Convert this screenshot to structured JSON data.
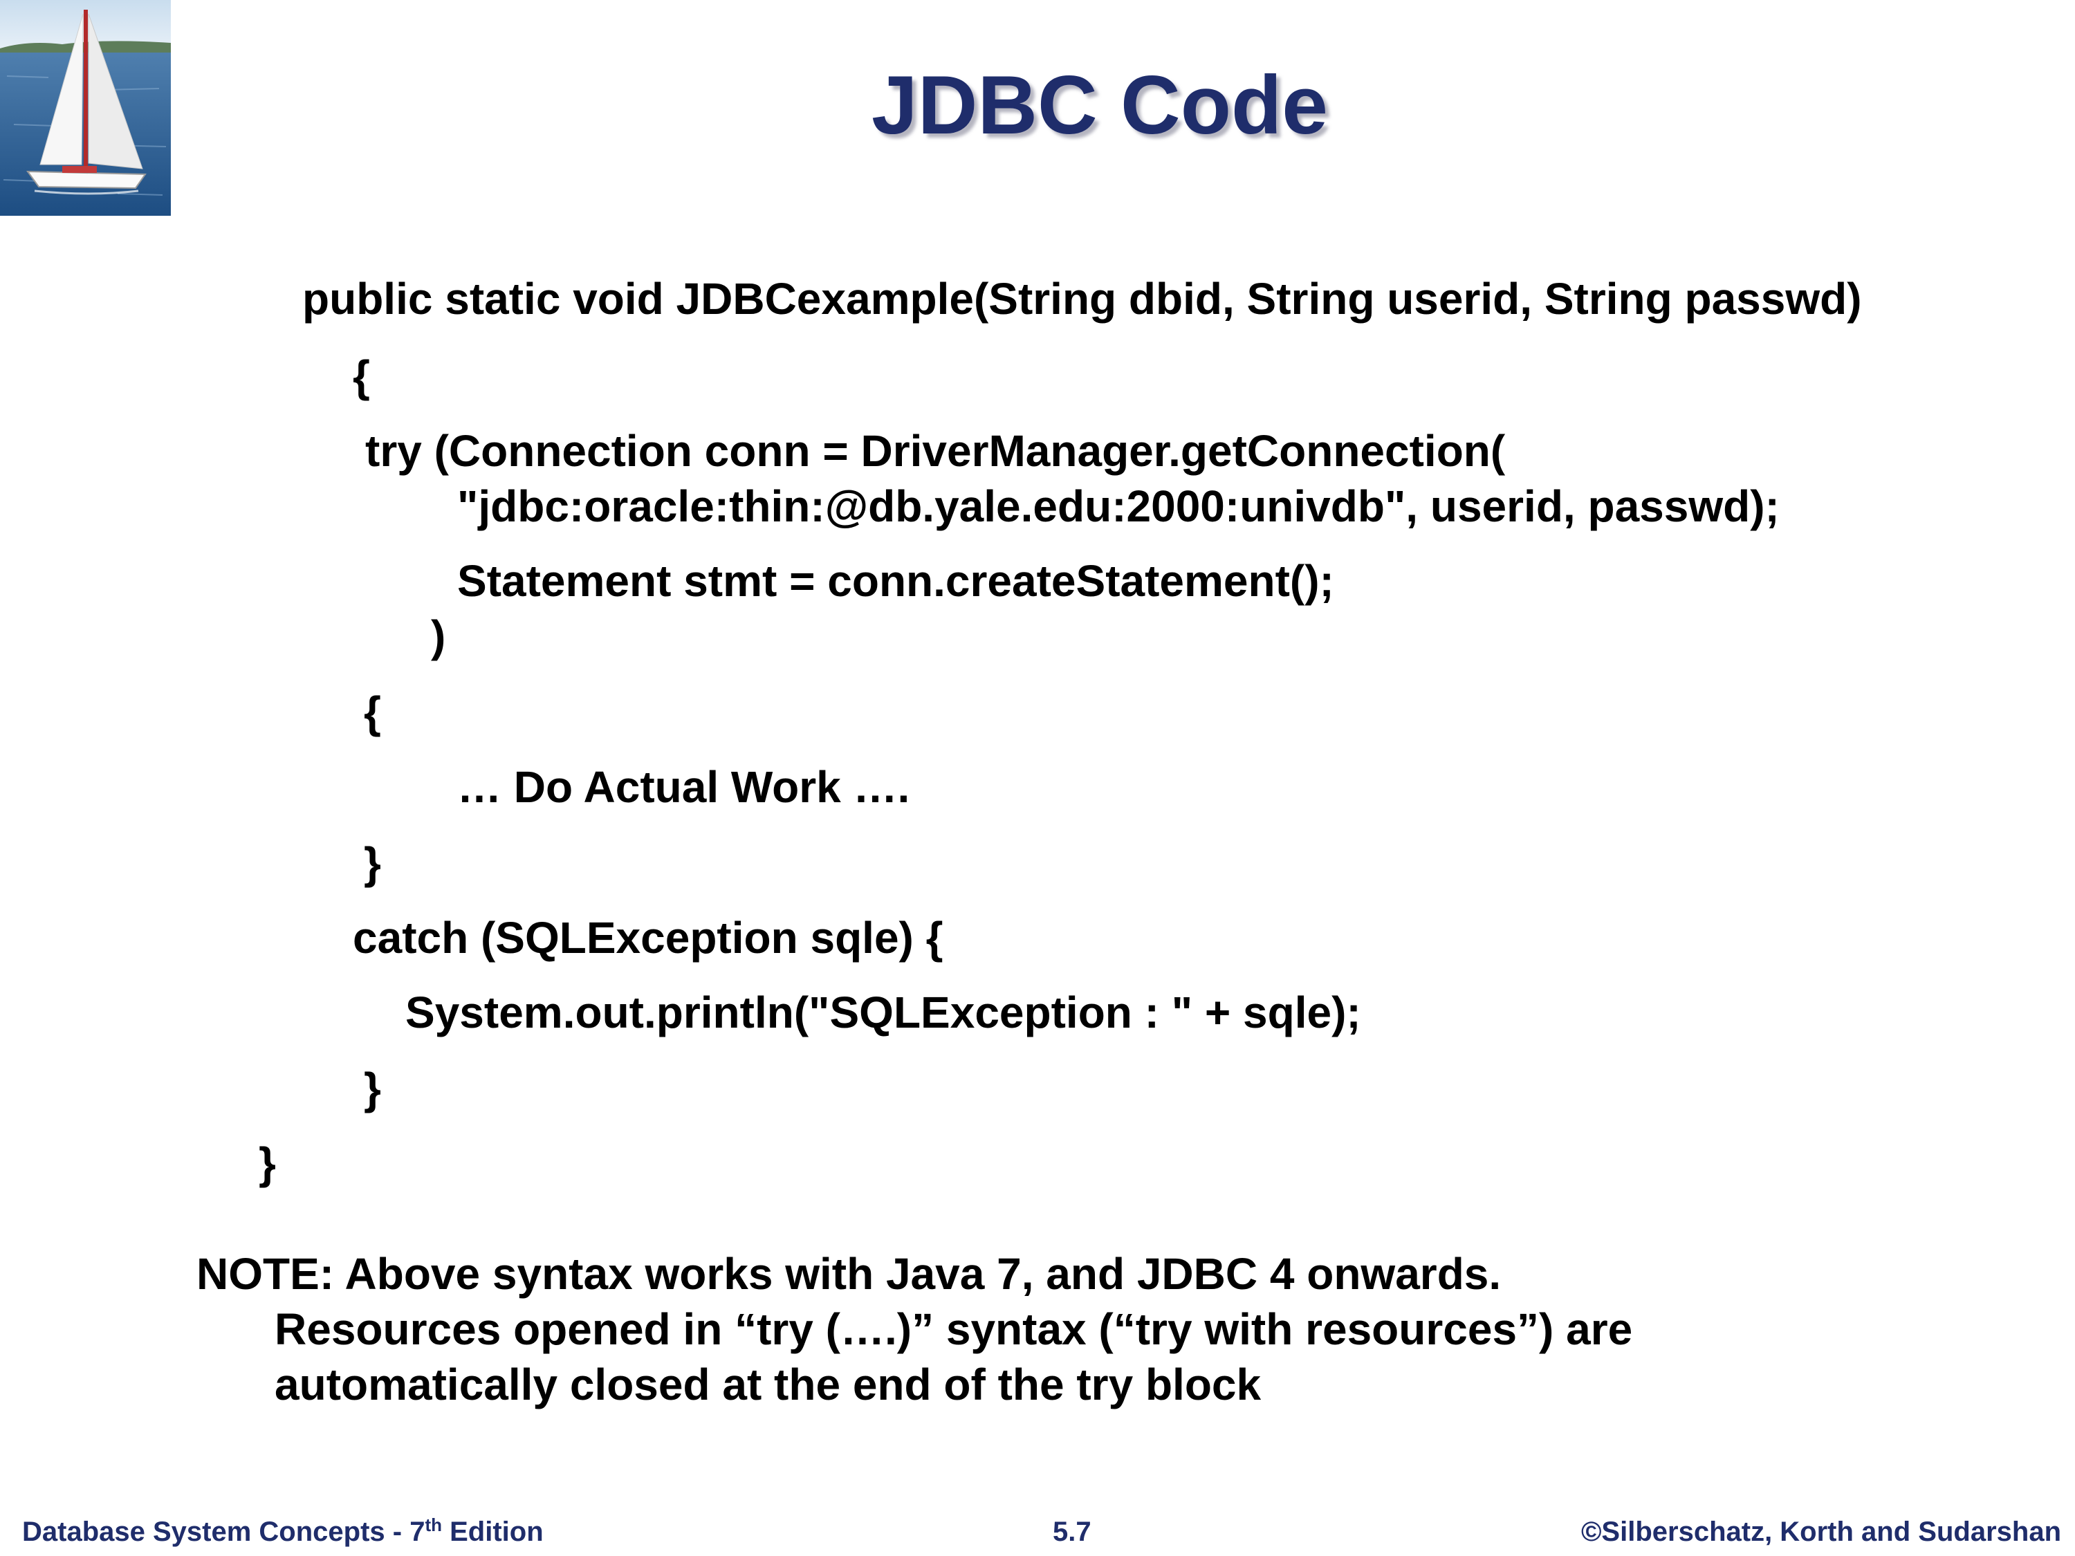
{
  "slide": {
    "title": "JDBC Code",
    "code_lines": [
      "public static void JDBCexample(String dbid, String userid, String passwd)",
      "{",
      "try (Connection conn = DriverManager.getConnection(",
      "\"jdbc:oracle:thin:@db.yale.edu:2000:univdb\", userid, passwd);",
      "Statement stmt = conn.createStatement();",
      ")",
      "{",
      "… Do Actual Work ….",
      "}",
      "catch (SQLException sqle) {",
      "System.out.println(\"SQLException : \" + sqle);",
      "}",
      "}"
    ],
    "note_lines": [
      "NOTE: Above syntax works with Java 7, and JDBC 4 onwards.",
      "Resources opened in “try (….)” syntax (“try with resources”) are",
      "automatically closed at the end of the try block"
    ]
  },
  "footer": {
    "left_text": "Database System Concepts - 7",
    "left_superscript": "th",
    "left_suffix": " Edition",
    "page_number": "5.7",
    "copyright": "©Silberschatz, Korth and Sudarshan"
  },
  "colors": {
    "title": "#1f2d6b",
    "footer": "#1f2d6b",
    "body_text": "#000000"
  },
  "icons": {
    "logo": "sailboat-logo"
  }
}
